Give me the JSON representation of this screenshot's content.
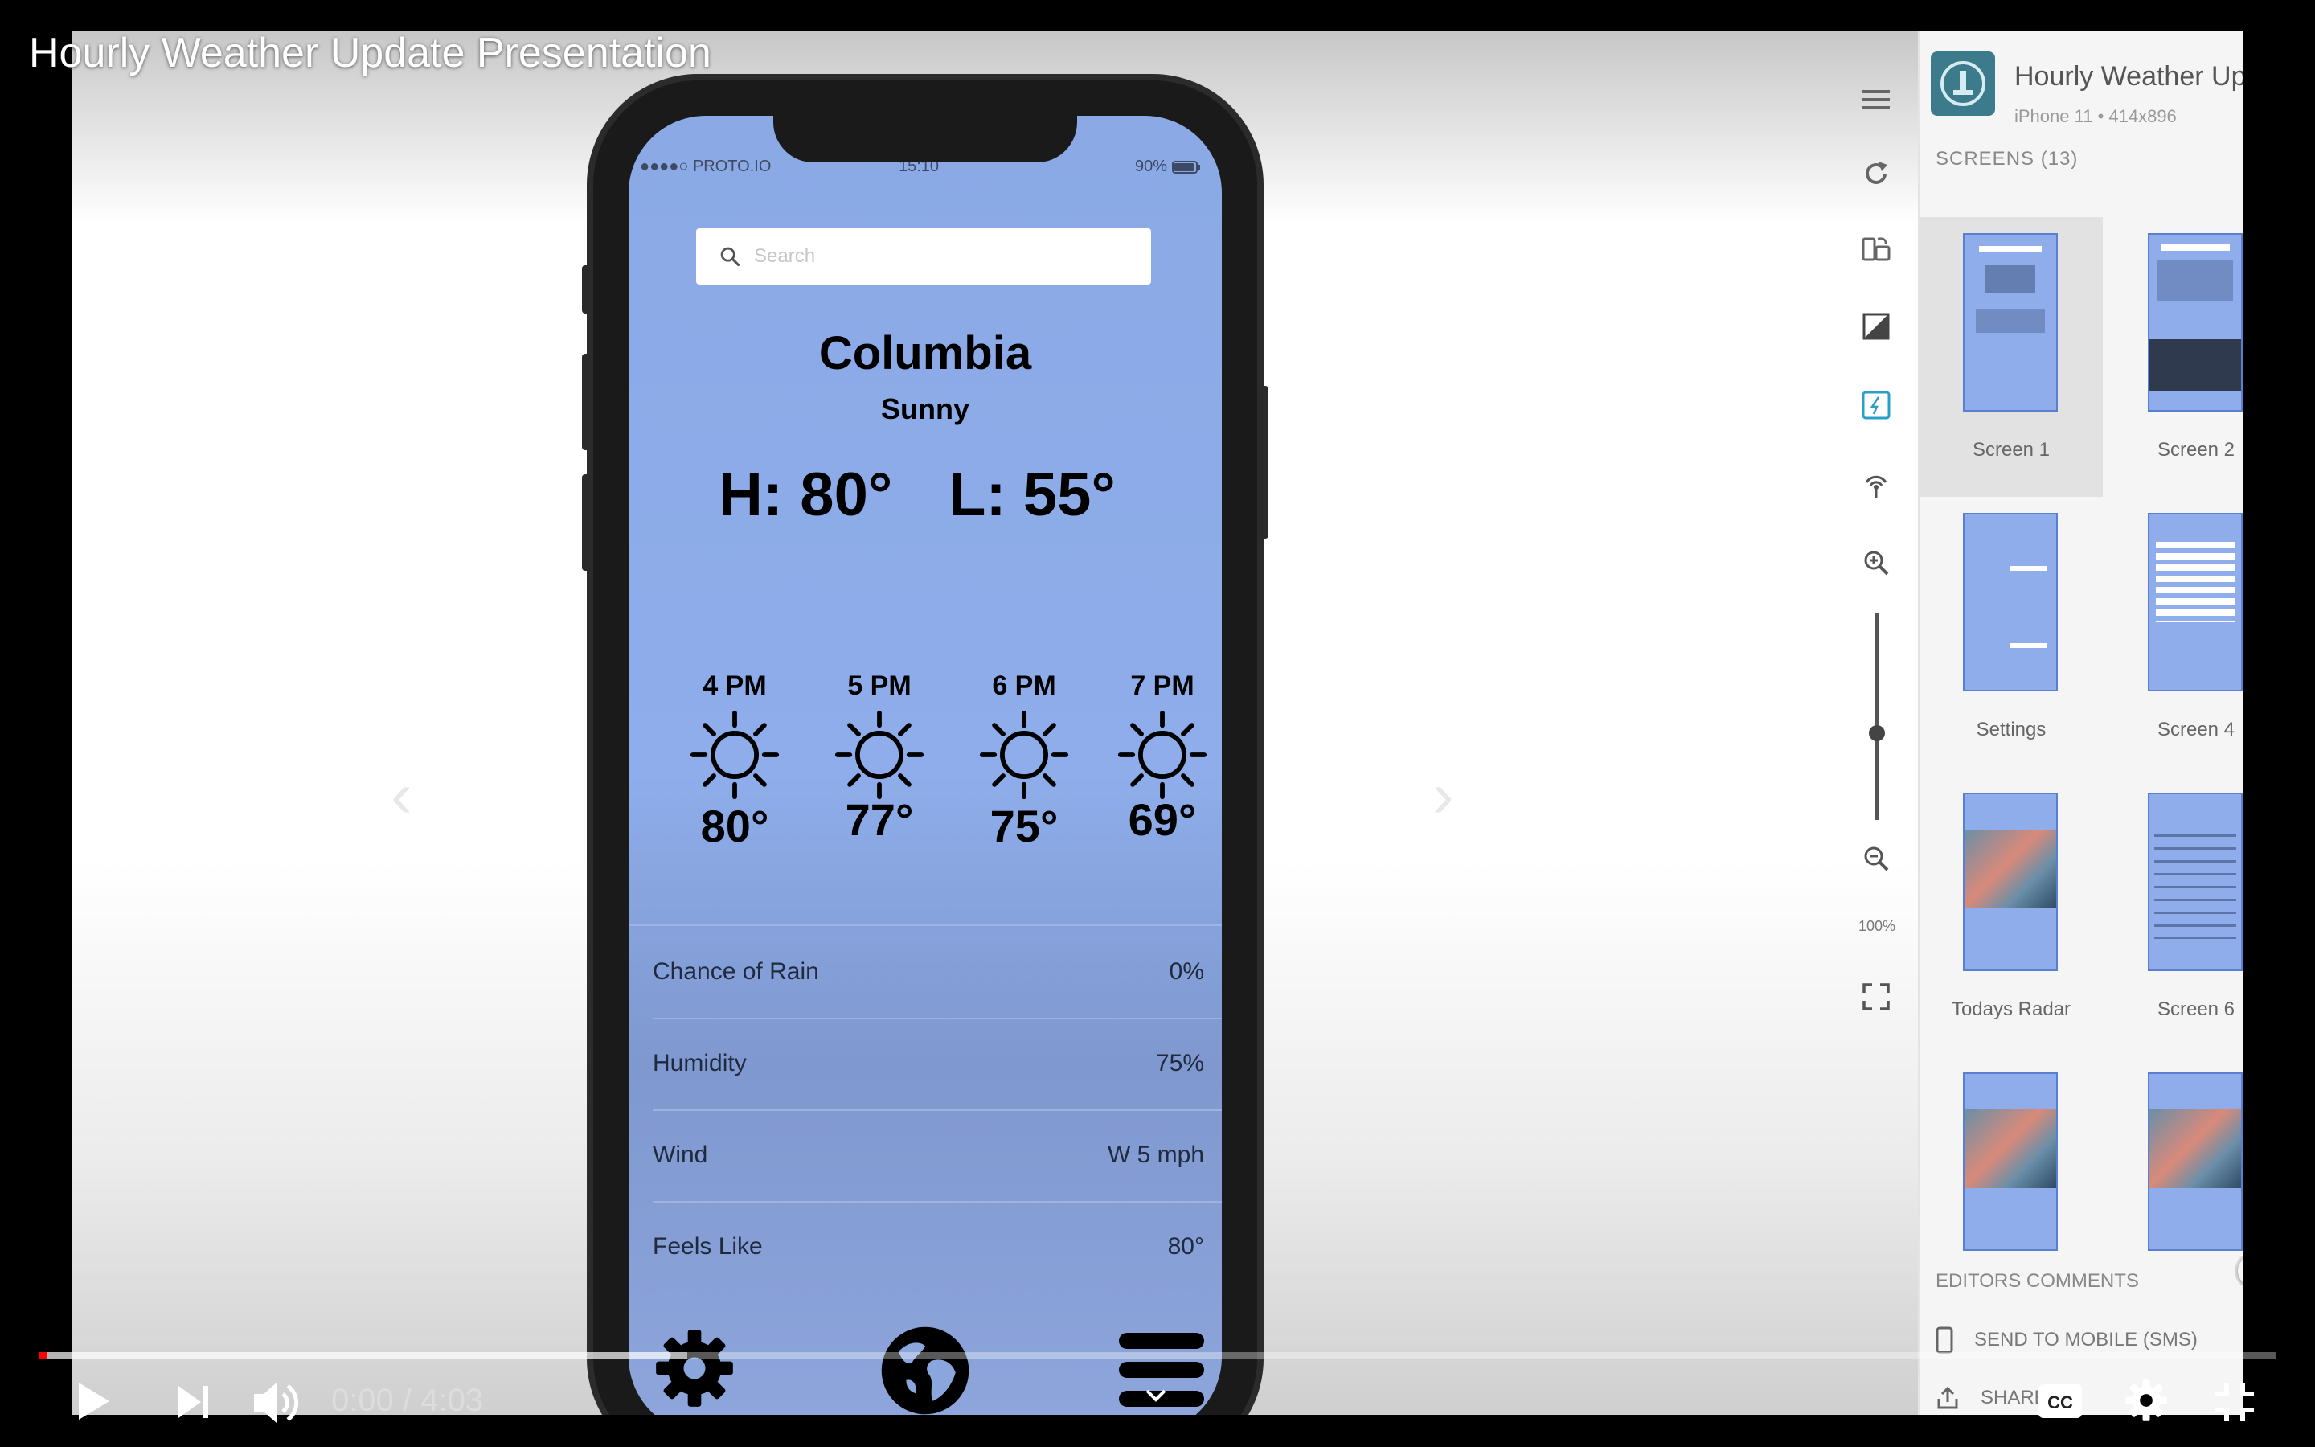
{
  "video": {
    "title": "Hourly Weather Update Presentation",
    "time_current": "0:00",
    "time_separator": "/",
    "time_total": "4:03",
    "progress": 0.0,
    "buffered": 0.29
  },
  "phone": {
    "status": {
      "carrier": "●●●●○ PROTO.IO",
      "time": "15:10",
      "battery": "90%"
    },
    "search": {
      "placeholder": "Search"
    },
    "city": "Columbia",
    "condition": "Sunny",
    "high": "H: 80°",
    "low": "L: 55°",
    "hourly": [
      {
        "time": "4 PM",
        "temp": "80°"
      },
      {
        "time": "5 PM",
        "temp": "77°"
      },
      {
        "time": "6 PM",
        "temp": "75°"
      },
      {
        "time": "7 PM",
        "temp": "69°"
      }
    ],
    "details": [
      {
        "label": "Chance of Rain",
        "value": "0%"
      },
      {
        "label": "Humidity",
        "value": "75%"
      },
      {
        "label": "Wind",
        "value": "W 5 mph"
      },
      {
        "label": "Feels Like",
        "value": "80°"
      }
    ]
  },
  "toolbar": {
    "zoom_label": "100%",
    "zoom_level": 0.6
  },
  "panel": {
    "project_title": "Hourly Weather Update ...",
    "project_subtitle": "iPhone 11 • 414x896",
    "screens_label": "SCREENS (13)",
    "screens": [
      {
        "label": "Screen 1"
      },
      {
        "label": "Screen 2"
      },
      {
        "label": "Settings"
      },
      {
        "label": "Screen 4"
      },
      {
        "label": "Todays Radar"
      },
      {
        "label": "Screen 6"
      },
      {
        "label": ""
      },
      {
        "label": ""
      }
    ],
    "editors_comments": "EDITORS COMMENTS",
    "send_to_mobile": "SEND TO MOBILE (SMS)",
    "share": "SHARE"
  },
  "colors": {
    "screen_bg": "#8aa9e5",
    "progress_red": "#ff0000",
    "panel_bg": "#f5f5f5",
    "app_icon": "#3b7b8c"
  },
  "icons": {
    "toolbar": [
      "menu-icon",
      "refresh-icon",
      "rotate-device-icon",
      "contrast-icon",
      "hotspot-icon",
      "antenna-icon",
      "zoom-in-icon",
      "zoom-out-icon",
      "fullscreen-icon"
    ],
    "tab_bar": [
      "gear-icon",
      "globe-icon",
      "hamburger-icon"
    ],
    "player": [
      "play-icon",
      "next-icon",
      "volume-icon",
      "chevron-down-icon",
      "cc-icon",
      "settings-gear-icon",
      "exit-fullscreen-icon"
    ]
  }
}
